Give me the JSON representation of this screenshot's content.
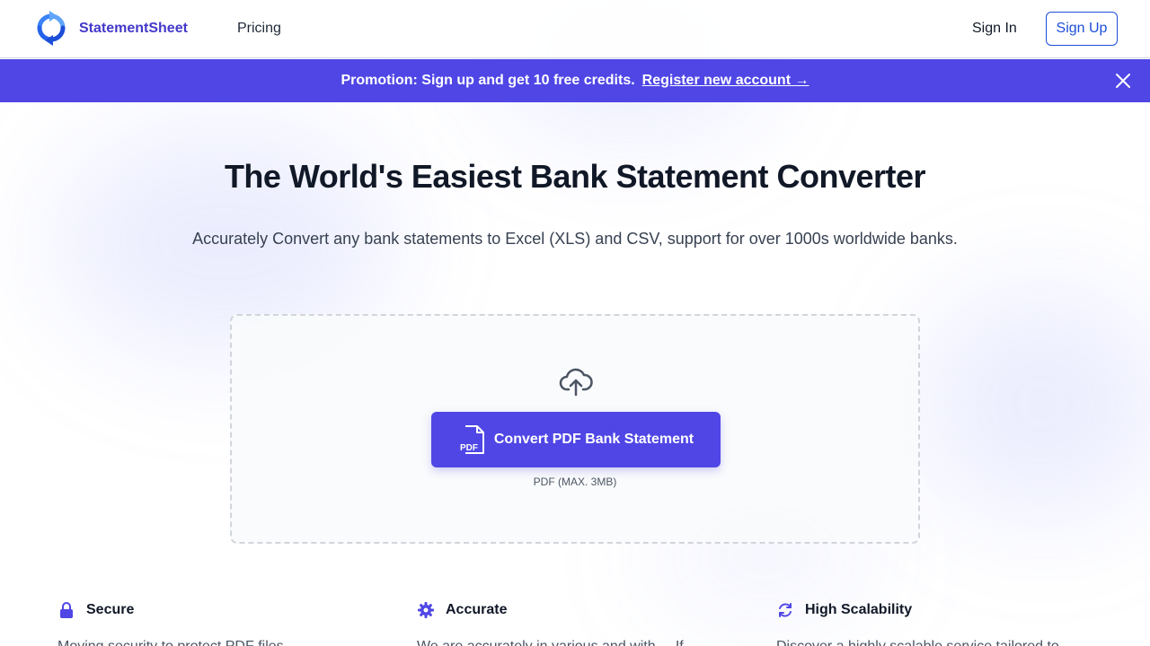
{
  "header": {
    "brand": "StatementSheet",
    "nav_pricing": "Pricing",
    "sign_in": "Sign In",
    "sign_up": "Sign Up",
    "logo_icon": "refresh-logo-icon"
  },
  "promo": {
    "text": "Promotion: Sign up and get 10 free credits.",
    "link": "Register new account →",
    "close_icon": "close-icon"
  },
  "hero": {
    "title": "The World's Easiest Bank Statement Converter",
    "subtitle": "Accurately Convert any bank statements to Excel (XLS) and CSV, support for over 1000s worldwide banks."
  },
  "upload": {
    "button_label": "Convert PDF Bank Statement",
    "pdf_icon_text": "PDF",
    "limit_text": "PDF (MAX. 3MB)",
    "upload_icon": "cloud-upload-icon"
  },
  "features": [
    {
      "title": "Secure",
      "icon": "lock-icon",
      "desc": "Moving security to protect PDF files..."
    },
    {
      "title": "Accurate",
      "icon": "gear-icon",
      "desc": "We are accurately in various and with ... If"
    },
    {
      "title": "High Scalability",
      "icon": "refresh-icon",
      "desc": "Discover a highly scalable service tailored to"
    }
  ],
  "colors": {
    "accent": "#4f46e5",
    "brand_text": "#4338ca",
    "signup_border": "#1d4ed8"
  }
}
